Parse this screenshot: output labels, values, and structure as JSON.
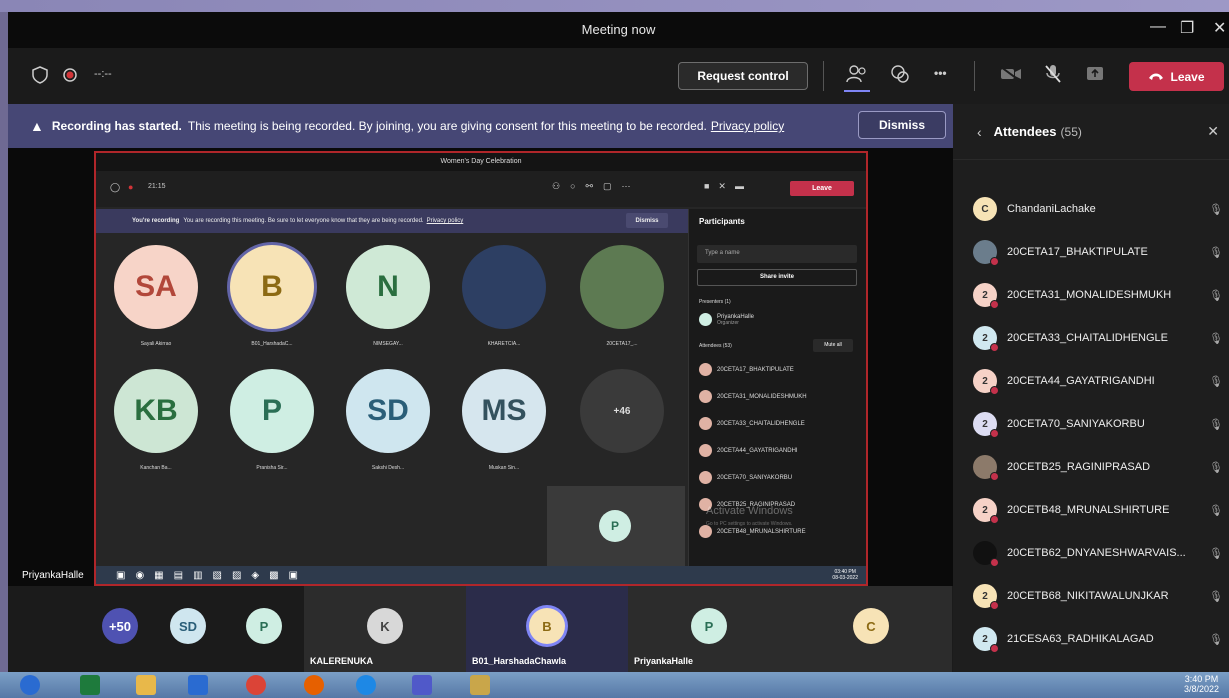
{
  "window": {
    "title": "Meeting now"
  },
  "toolbar": {
    "timer": "--:--",
    "request_control": "Request control",
    "more": "•••",
    "leave": "Leave"
  },
  "banner": {
    "bold": "Recording has started.",
    "text": "This meeting is being recorded. By joining, you are giving consent for this meeting to be recorded.",
    "link": "Privacy policy",
    "dismiss": "Dismiss"
  },
  "shared_screen": {
    "title": "Women's Day Celebration",
    "time": "21:15",
    "leave": "Leave",
    "banner_bold": "You're recording",
    "banner_text": "You are recording this meeting. Be sure to let everyone know that they are being recorded.",
    "banner_link": "Privacy policy",
    "dismiss": "Dismiss",
    "tiles": [
      {
        "initials": "SA",
        "name": "Sayali Akirrao",
        "bg": "#f7d4c8",
        "fg": "#b2473a"
      },
      {
        "initials": "B",
        "name": "B01_HarshadaC...",
        "bg": "#f7e3b6",
        "fg": "#8c6a13"
      },
      {
        "initials": "N",
        "name": "NIMSEGAY...",
        "bg": "#cfe9d6",
        "fg": "#2a6e3f"
      },
      {
        "initials": "",
        "name": "KHARETCIA...",
        "bg": "#2d3f63",
        "fg": "#fff"
      },
      {
        "initials": "",
        "name": "20CETA17_...",
        "bg": "#5d7a52",
        "fg": "#fff"
      },
      {
        "initials": "KB",
        "name": "Kanchan Ba...",
        "bg": "#cde6d4",
        "fg": "#2a6e3f"
      },
      {
        "initials": "P",
        "name": "Pranisha Sir...",
        "bg": "#cfeee3",
        "fg": "#2a6e55"
      },
      {
        "initials": "SD",
        "name": "Sakshi Desh...",
        "bg": "#cfe6ef",
        "fg": "#2a5e78"
      },
      {
        "initials": "MS",
        "name": "Muskan Sin...",
        "bg": "#d6e6ee",
        "fg": "#34525e"
      },
      {
        "initials": "+46",
        "name": "",
        "bg": "#3a3a3a",
        "fg": "#ddd"
      }
    ],
    "self_initial": "P",
    "panel_title": "Participants",
    "search_placeholder": "Type a name",
    "share_invite": "Share invite",
    "presenters_label": "Presenters (1)",
    "presenter_name": "PriyankaHalle",
    "presenter_role": "Organizer",
    "attendees_label": "Attendees (53)",
    "mute_all": "Mute all",
    "attendees": [
      "20CETA17_BHAKTIPULATE",
      "20CETA31_MONALIDESHMUKH",
      "20CETA33_CHAITALIDHENGLE",
      "20CETA44_GAYATRIGANDHI",
      "20CETA70_SANIYAKORBU",
      "20CETB25_RAGINIPRASAD",
      "20CETB48_MRUNALSHIRTURE"
    ],
    "presenter_label": "PriyankaHalle",
    "watermark": "Activate Windows",
    "watermark_sub": "Go to PC settings to activate Windows.",
    "tray_time": "03:40 PM",
    "tray_date": "08-03-2022"
  },
  "bottom_strip": [
    {
      "initials": "+50",
      "label": "",
      "bg": "#4f52b2",
      "fg": "#fff"
    },
    {
      "initials": "SD",
      "label": "",
      "bg": "#cfe6ef",
      "fg": "#2a5e78"
    },
    {
      "initials": "P",
      "label": "",
      "bg": "#cfeee3",
      "fg": "#2a6e55"
    },
    {
      "initials": "K",
      "label": "KALERENUKA",
      "bg": "#d8d8d8",
      "fg": "#444"
    },
    {
      "initials": "B",
      "label": "B01_HarshadaChawla",
      "bg": "#f7e3b6",
      "fg": "#8c6a13"
    },
    {
      "initials": "P",
      "label": "PriyankaHalle",
      "bg": "#cfeee3",
      "fg": "#2a6e55"
    },
    {
      "initials": "C",
      "label": "",
      "bg": "#f7e3b6",
      "fg": "#8c6a13"
    }
  ],
  "attendees_panel": {
    "title": "Attendees",
    "count": "(55)",
    "items": [
      {
        "initial": "C",
        "name": "ChandaniLachake",
        "bg": "#f7e3b6"
      },
      {
        "initial": "",
        "name": "20CETA17_BHAKTIPULATE",
        "bg": "#6b7d8c"
      },
      {
        "initial": "2",
        "name": "20CETA31_MONALIDESHMUKH",
        "bg": "#f6d2c7"
      },
      {
        "initial": "2",
        "name": "20CETA33_CHAITALIDHENGLE",
        "bg": "#d0e8f0"
      },
      {
        "initial": "2",
        "name": "20CETA44_GAYATRIGANDHI",
        "bg": "#f6d2c7"
      },
      {
        "initial": "2",
        "name": "20CETA70_SANIYAKORBU",
        "bg": "#dcdcf2"
      },
      {
        "initial": "",
        "name": "20CETB25_RAGINIPRASAD",
        "bg": "#8c7a6a"
      },
      {
        "initial": "2",
        "name": "20CETB48_MRUNALSHIRTURE",
        "bg": "#f6d2c7"
      },
      {
        "initial": "",
        "name": "20CETB62_DNYANESHWARVAIS...",
        "bg": "#111111"
      },
      {
        "initial": "2",
        "name": "20CETB68_NIKITAWALUNJKAR",
        "bg": "#f7e3b6"
      },
      {
        "initial": "2",
        "name": "21CESA63_RADHIKALAGAD",
        "bg": "#d0e8f0"
      }
    ]
  },
  "taskbar": {
    "time": "3:40 PM",
    "date": "3/8/2022"
  },
  "icons": [
    "shield-icon",
    "record-icon",
    "participants-icon",
    "chat-icon",
    "more-icon",
    "camera-off-icon",
    "mic-off-icon",
    "share-icon",
    "phone-icon",
    "close-icon",
    "back-icon",
    "mic-muted-icon"
  ]
}
